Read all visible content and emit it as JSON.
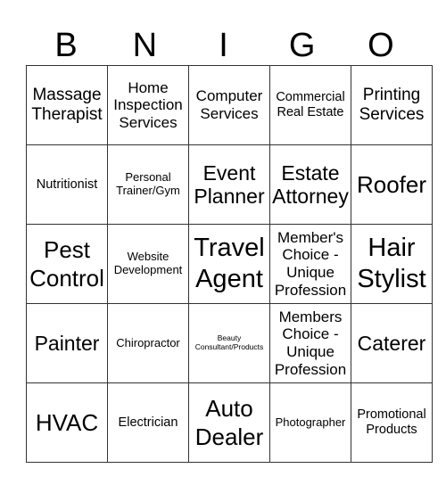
{
  "header": {
    "letters": [
      "B",
      "N",
      "I",
      "G",
      "O"
    ]
  },
  "card": {
    "rows": [
      [
        "Massage Therapist",
        "Home Inspection Services",
        "Computer Services",
        "Commercial Real Estate",
        "Printing Services"
      ],
      [
        "Nutritionist",
        "Personal Trainer/Gym",
        "Event Planner",
        "Estate Attorney",
        "Roofer"
      ],
      [
        "Pest Control",
        "Website Development",
        "Travel Agent",
        "Member's Choice - Unique Profession",
        "Hair Stylist"
      ],
      [
        "Painter",
        "Chiropractor",
        "Beauty Consultant/Products",
        "Members Choice - Unique Profession",
        "Caterer"
      ],
      [
        "HVAC",
        "Electrician",
        "Auto Dealer",
        "Photographer",
        "Promotional Products"
      ]
    ]
  }
}
